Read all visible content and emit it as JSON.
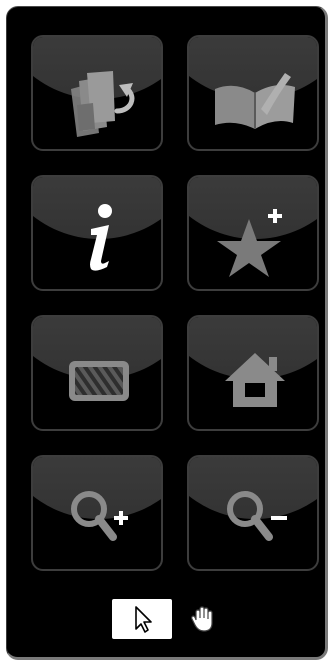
{
  "toolbar": {
    "buttons": [
      {
        "id": "pages",
        "icon": "pages-undo-icon"
      },
      {
        "id": "book",
        "icon": "open-book-icon"
      },
      {
        "id": "info",
        "icon": "info-icon",
        "glyph": "i"
      },
      {
        "id": "bookmark",
        "icon": "star-plus-icon",
        "glyph": "+"
      },
      {
        "id": "thumbnails",
        "icon": "striped-box-icon"
      },
      {
        "id": "home",
        "icon": "home-icon"
      },
      {
        "id": "zoom-in",
        "icon": "zoom-in-icon",
        "glyph": "+"
      },
      {
        "id": "zoom-out",
        "icon": "zoom-out-icon",
        "glyph": "-"
      }
    ],
    "tools": [
      {
        "id": "select",
        "icon": "arrow-cursor-icon",
        "selected": true
      },
      {
        "id": "pan",
        "icon": "hand-icon",
        "selected": false
      }
    ]
  },
  "colors": {
    "panel_background": "#000000",
    "tile_border": "#3d3d3d",
    "icon_gray": "#8a8a8a",
    "icon_white": "#ffffff",
    "selected_tool_background": "#ffffff"
  }
}
